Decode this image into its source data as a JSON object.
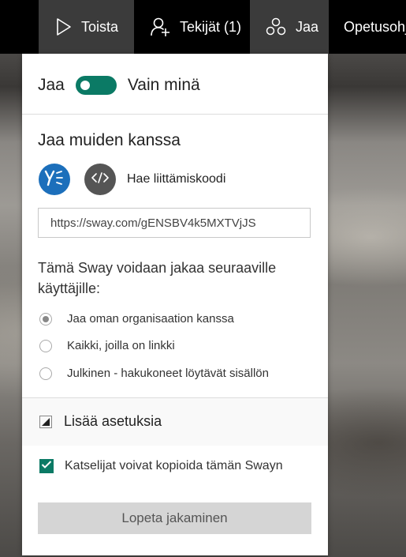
{
  "nav": {
    "play_label": "Toista",
    "authors_label": "Tekijät (1)",
    "share_label": "Jaa",
    "tutorials_label": "Opetusohj"
  },
  "share_panel": {
    "toggle_left_label": "Jaa",
    "toggle_state_label": "Vain minä",
    "toggle_on": true,
    "section_title": "Jaa muiden kanssa",
    "embed_label": "Hae liittämiskoodi",
    "share_url": "https://sway.com/gENSBV4k5MXTVjJS",
    "audience_description": "Tämä Sway voidaan jakaa seuraaville käyttäjille:",
    "audience_options": [
      {
        "label": "Jaa oman organisaation kanssa",
        "selected": true
      },
      {
        "label": "Kaikki, joilla on linkki",
        "selected": false
      },
      {
        "label": "Julkinen - hakukoneet löytävät sisällön",
        "selected": false
      }
    ],
    "more_settings_label": "Lisää asetuksia",
    "copy_checkbox_label": "Katselijat voivat kopioida tämän Swayn",
    "copy_checkbox_checked": true,
    "stop_sharing_label": "Lopeta jakaminen"
  },
  "colors": {
    "accent": "#0b7a65",
    "yammer": "#1c6fbb",
    "topbar": "#000000"
  },
  "icons": {
    "play": "play-icon",
    "authors": "add-person-icon",
    "share": "share-icon",
    "yammer": "yammer-icon",
    "embed": "code-icon",
    "more": "expand-triangle-icon",
    "check": "checkmark-icon"
  }
}
